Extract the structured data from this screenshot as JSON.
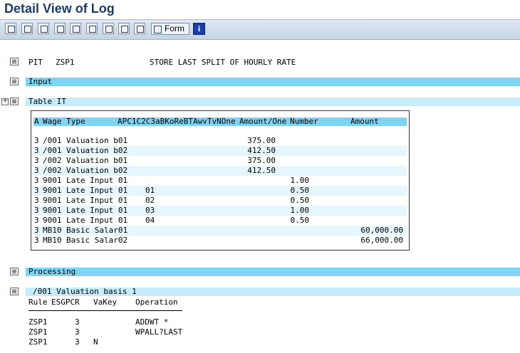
{
  "window": {
    "title": "Detail View of Log"
  },
  "toolbar": {
    "buttons": [
      {
        "name": "expand-all-icon"
      },
      {
        "name": "expand-subtree-icon"
      },
      {
        "name": "collapse-icon"
      },
      {
        "name": "move-up-icon"
      },
      {
        "name": "find-icon"
      },
      {
        "name": "list-icon"
      },
      {
        "name": "structure-icon"
      },
      {
        "name": "compare-icon"
      },
      {
        "name": "copy-icon"
      }
    ],
    "form_label": "Form",
    "info_label": "i"
  },
  "header": {
    "pit": "PIT",
    "schema": "ZSP1",
    "description": "STORE LAST SPLIT OF HOURLY RATE"
  },
  "sections": {
    "input": "Input",
    "table_it": "Table IT",
    "processing": "Processing"
  },
  "table": {
    "columns": {
      "a": "A",
      "wage_type": "Wage Type",
      "apc": "APC1C2C3aBKoReBTAwvTvNOne",
      "amount_one": "Amount/One",
      "number": "Number",
      "amount": "Amount"
    },
    "rows": [
      {
        "a": "3",
        "wt": "/001",
        "text": "Valuation b01",
        "c2": "",
        "amount_one": "375.00",
        "number": "",
        "amount": ""
      },
      {
        "a": "3",
        "wt": "/001",
        "text": "Valuation b02",
        "c2": "",
        "amount_one": "412.50",
        "number": "",
        "amount": ""
      },
      {
        "a": "3",
        "wt": "/002",
        "text": "Valuation b01",
        "c2": "",
        "amount_one": "375.00",
        "number": "",
        "amount": ""
      },
      {
        "a": "3",
        "wt": "/002",
        "text": "Valuation b02",
        "c2": "",
        "amount_one": "412.50",
        "number": "",
        "amount": ""
      },
      {
        "a": "3",
        "wt": "9001",
        "text": "Late Input 01",
        "c2": "",
        "amount_one": "",
        "number": "1.00",
        "amount": ""
      },
      {
        "a": "3",
        "wt": "9001",
        "text": "Late Input 01",
        "c2": "01",
        "amount_one": "",
        "number": "0.50",
        "amount": ""
      },
      {
        "a": "3",
        "wt": "9001",
        "text": "Late Input 01",
        "c2": "02",
        "amount_one": "",
        "number": "0.50",
        "amount": ""
      },
      {
        "a": "3",
        "wt": "9001",
        "text": "Late Input 01",
        "c2": "03",
        "amount_one": "",
        "number": "1.00",
        "amount": ""
      },
      {
        "a": "3",
        "wt": "9001",
        "text": "Late Input 01",
        "c2": "04",
        "amount_one": "",
        "number": "0.50",
        "amount": ""
      },
      {
        "a": "3",
        "wt": "MB10",
        "text": "Basic Salar01",
        "c2": "",
        "amount_one": "",
        "number": "",
        "amount": "60,000.00"
      },
      {
        "a": "3",
        "wt": "MB10",
        "text": "Basic Salar02",
        "c2": "",
        "amount_one": "",
        "number": "",
        "amount": "66,000.00"
      }
    ]
  },
  "processing": {
    "node_label": "/001 Valuation basis 1",
    "columns": {
      "rule": "Rule",
      "esgpcr": "ESGPCR",
      "vakey": "VaKey",
      "operation": "Operation"
    },
    "rows": [
      {
        "rule": "ZSP1",
        "esg": "3",
        "vakey": "",
        "operation": "ADDWT *"
      },
      {
        "rule": "ZSP1",
        "esg": "3",
        "vakey": "",
        "operation": "WPALL?LAST"
      },
      {
        "rule": "ZSP1",
        "esg": "3",
        "vakey": "N",
        "operation": ""
      }
    ]
  }
}
